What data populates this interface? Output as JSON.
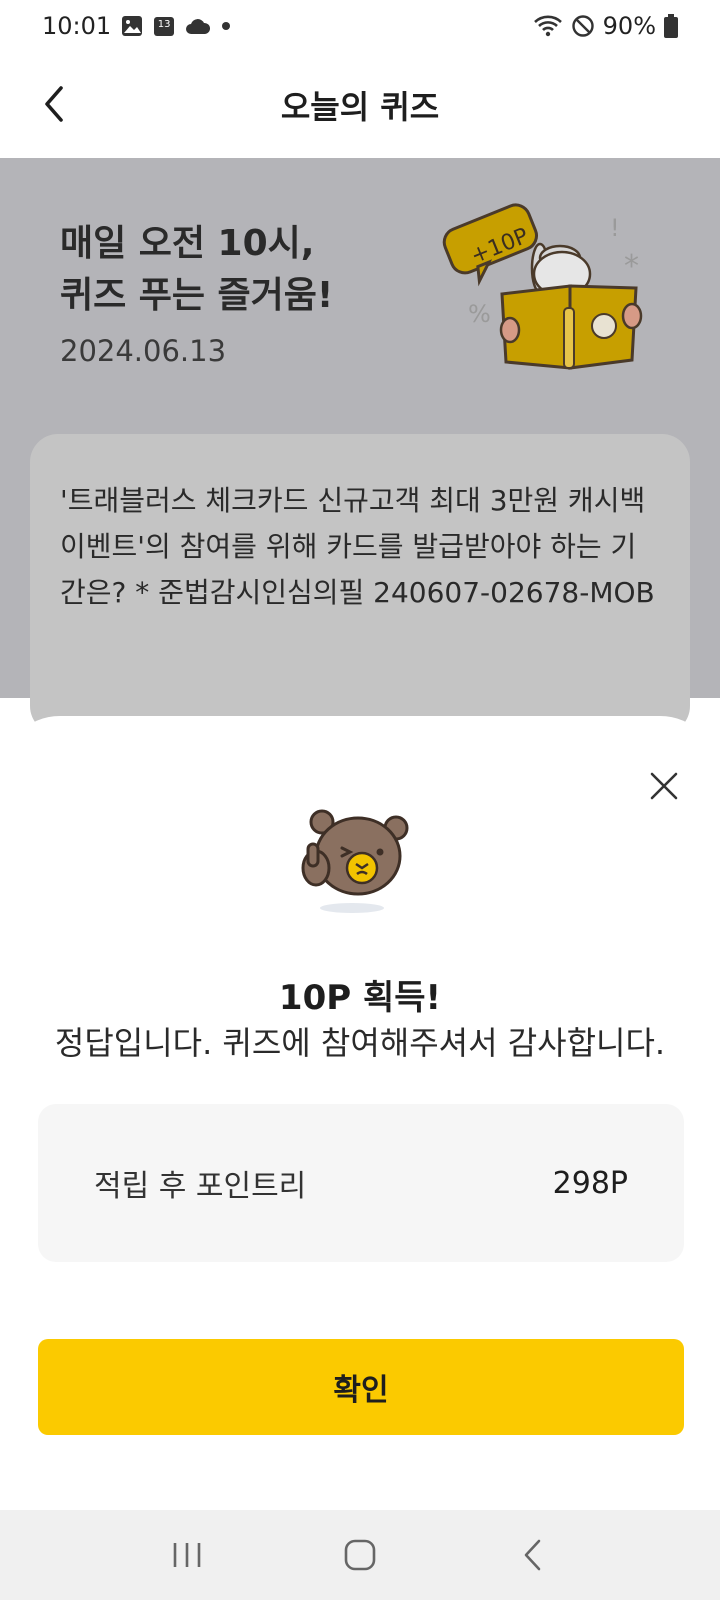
{
  "status_bar": {
    "time": "10:01",
    "icons_left": [
      "image-icon",
      "calendar-icon",
      "cloud-icon",
      "dot-icon"
    ],
    "calendar_day": "13",
    "icons_right": [
      "wifi-icon",
      "do-not-disturb-icon",
      "battery-icon"
    ],
    "battery": "90%"
  },
  "app_bar": {
    "back_icon": "chevron-left-icon",
    "title": "오늘의 퀴즈"
  },
  "hero": {
    "line1": "매일 오전 10시,",
    "line2": "퀴즈 푸는 즐거움!",
    "date": "2024.06.13",
    "badge": "+10P"
  },
  "question": {
    "text": "'트래블러스 체크카드 신규고객 최대 3만원 캐시백 이벤트'의 참여를 위해 카드를 발급받아야 하는 기간은? * 준법감시인심의필 240607-02678-MOB"
  },
  "result_sheet": {
    "close_icon": "close-icon",
    "title": "10P 획득!",
    "message": "정답입니다. 퀴즈에 참여해주셔서 감사합니다.",
    "points_label": "적립 후 포인트리",
    "points_value": "298P",
    "confirm_label": "확인"
  },
  "nav_bar": {
    "items": [
      "recent-apps-icon",
      "home-icon",
      "back-icon"
    ]
  },
  "colors": {
    "accent": "#fbca00",
    "dim_bg": "#b4b4b8",
    "card_bg": "#c4c4c4",
    "points_bg": "#f6f6f6"
  }
}
